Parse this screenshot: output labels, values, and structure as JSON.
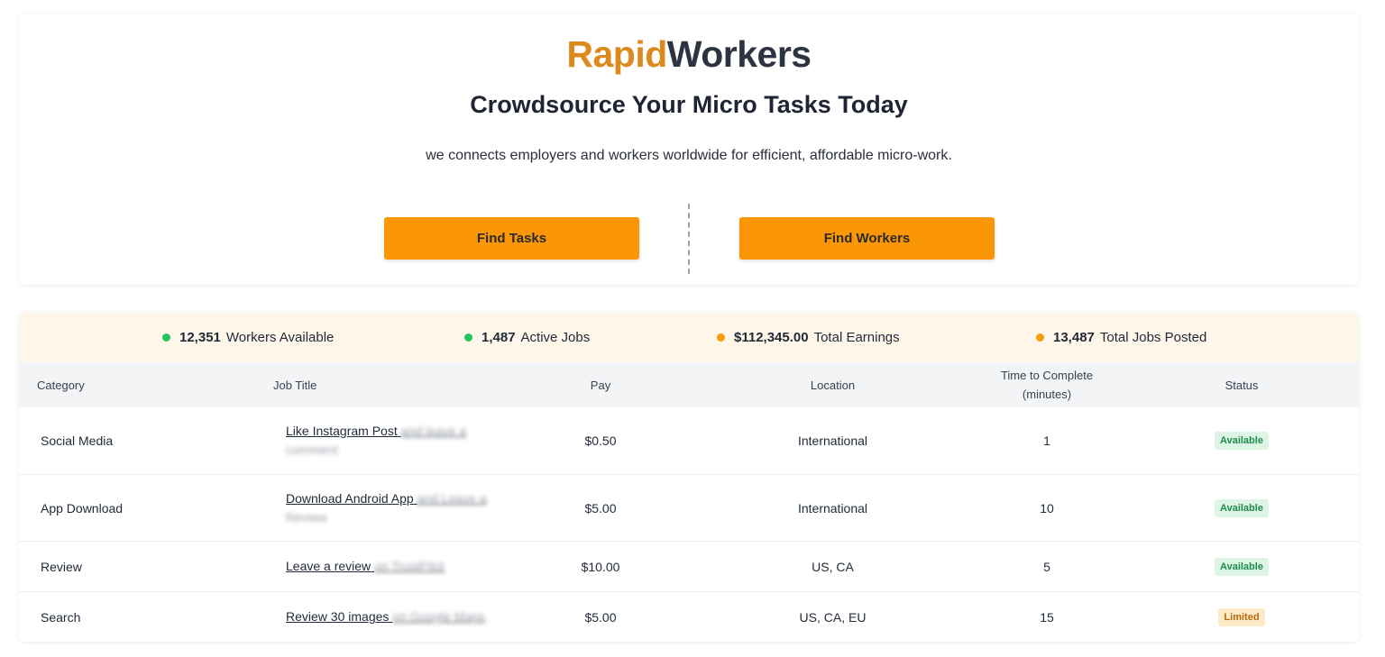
{
  "brand": {
    "part1": "Rapid",
    "part2": "Workers",
    "color1": "#dc8a1e",
    "color2": "#2d3340"
  },
  "hero": {
    "headline": "Crowdsource Your Micro Tasks Today",
    "subline": "we connects employers and workers worldwide for efficient, affordable micro-work.",
    "find_tasks": "Find Tasks",
    "find_workers": "Find Workers",
    "button_color": "#fb9606"
  },
  "stats": [
    {
      "value": "12,351",
      "label": "Workers Available",
      "dot": "#22c55e"
    },
    {
      "value": "1,487",
      "label": "Active Jobs",
      "dot": "#22c55e"
    },
    {
      "value": "$112,345.00",
      "label": "Total Earnings",
      "dot": "#f59e0b"
    },
    {
      "value": "13,487",
      "label": "Total Jobs Posted",
      "dot": "#f59e0b"
    }
  ],
  "table": {
    "headers": {
      "category": "Category",
      "job_title": "Job Title",
      "pay": "Pay",
      "location": "Location",
      "time_line1": "Time to Complete",
      "time_line2": "(minutes)",
      "status": "Status"
    },
    "rows": [
      {
        "category": "Social Media",
        "title": "Like Instagram Post",
        "title_blur": "and leave a",
        "title_blur2": "comment",
        "pay": "$0.50",
        "location": "International",
        "time": "1",
        "status": "Available"
      },
      {
        "category": "App Download",
        "title": "Download Android App",
        "title_blur": "and Leave a",
        "title_blur2": "Review",
        "pay": "$5.00",
        "location": "International",
        "time": "10",
        "status": "Available"
      },
      {
        "category": "Review",
        "title": "Leave a review",
        "title_blur": "on TrustPilot",
        "title_blur2": "",
        "pay": "$10.00",
        "location": "US, CA",
        "time": "5",
        "status": "Available"
      },
      {
        "category": "Search",
        "title": "Review 30 images",
        "title_blur": "on Google Maps",
        "title_blur2": "",
        "pay": "$5.00",
        "location": "US, CA, EU",
        "time": "15",
        "status": "Limited"
      }
    ]
  }
}
